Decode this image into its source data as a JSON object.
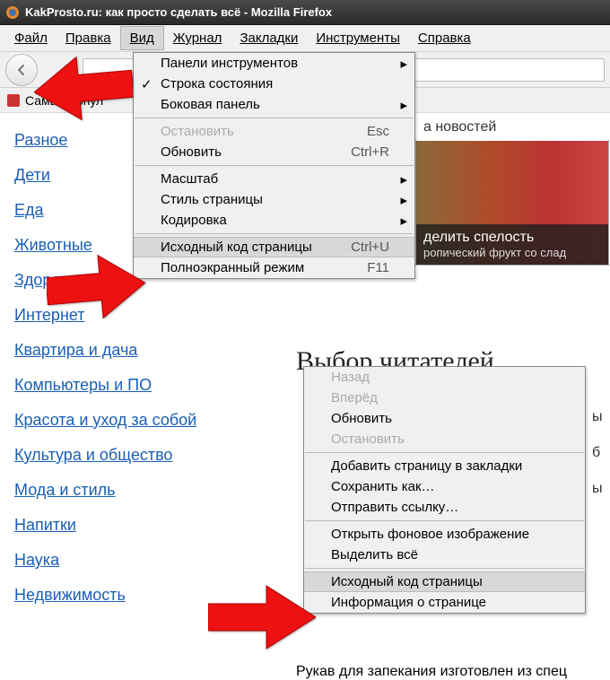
{
  "window": {
    "title": "KakProsto.ru: как просто сделать всё - Mozilla Firefox"
  },
  "menubar": {
    "file": "Файл",
    "edit": "Правка",
    "view": "Вид",
    "history": "Журнал",
    "bookmarks": "Закладки",
    "tools": "Инструменты",
    "help": "Справка"
  },
  "bookmarks_bar": {
    "label": "Самые попул"
  },
  "view_menu": {
    "toolbars": "Панели инструментов",
    "statusbar": "Строка состояния",
    "sidebar": "Боковая панель",
    "stop": "Остановить",
    "stop_key": "Esc",
    "reload": "Обновить",
    "reload_key": "Ctrl+R",
    "zoom": "Масштаб",
    "page_style": "Стиль страницы",
    "encoding": "Кодировка",
    "source": "Исходный код страницы",
    "source_key": "Ctrl+U",
    "fullscreen": "Полноэкранный режим",
    "fullscreen_key": "F11"
  },
  "context_menu": {
    "back": "Назад",
    "forward": "Вперёд",
    "reload": "Обновить",
    "stop": "Остановить",
    "bookmark": "Добавить страницу в закладки",
    "saveas": "Сохранить как…",
    "sendlink": "Отправить ссылку…",
    "view_bg": "Открыть фоновое изображение",
    "select_all": "Выделить всё",
    "source": "Исходный код страницы",
    "page_info": "Информация о странице"
  },
  "sidebar": {
    "items": [
      "Разное",
      "Дети",
      "Еда",
      "Животные",
      "Здоровье",
      "Интернет",
      "Квартира и дача",
      "Компьютеры и ПО",
      "Красота и уход за собой",
      "Культура и общество",
      "Мода и стиль",
      "Напитки",
      "Наука",
      "Недвижимость"
    ]
  },
  "page": {
    "news_link": "а новостей",
    "hero_title": "делить спелость",
    "hero_sub": "ропический фрукт со слад",
    "reader_choice": "Выбор читателей",
    "bottom_text": "Рукав для запекания изготовлен из спец"
  }
}
